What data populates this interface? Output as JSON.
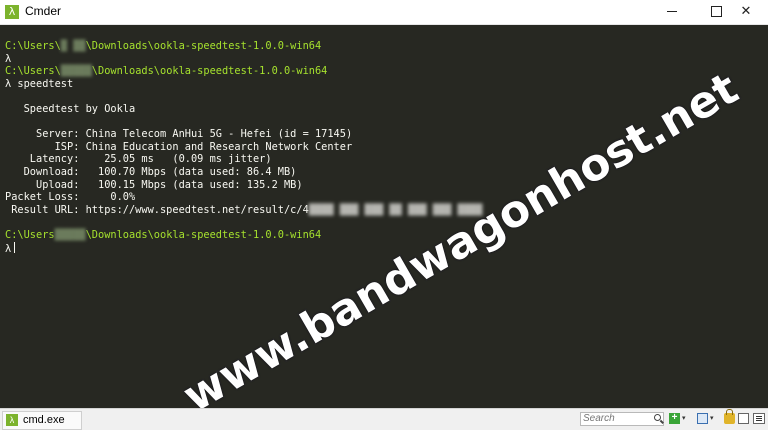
{
  "window": {
    "title": "Cmder",
    "icon_glyph": "λ",
    "controls": {
      "minimize": "minimize-icon",
      "maximize": "maximize-icon",
      "close": "✕"
    }
  },
  "console": {
    "colors": {
      "background": "#272822",
      "prompt_path": "#a6e22e",
      "text": "#f8f8f2"
    },
    "blocks": [
      {
        "type": "path",
        "prefix": "C:\\Users\\",
        "hidden": "█ ██",
        "suffix": "\\Downloads\\ookla-speedtest-1.0.0-win64"
      },
      {
        "type": "prompt",
        "text": "λ"
      },
      {
        "type": "path",
        "prefix": "C:\\Users\\",
        "hidden": "█████",
        "suffix": "\\Downloads\\ookla-speedtest-1.0.0-win64"
      },
      {
        "type": "prompt",
        "text": "λ speedtest"
      },
      {
        "type": "blank"
      },
      {
        "type": "text",
        "text": "   Speedtest by Ookla"
      },
      {
        "type": "blank"
      },
      {
        "type": "text",
        "text": "     Server: China Telecom AnHui 5G - Hefei (id = 17145)"
      },
      {
        "type": "text",
        "text": "        ISP: China Education and Research Network Center"
      },
      {
        "type": "text",
        "text": "    Latency:    25.05 ms   (0.09 ms jitter)"
      },
      {
        "type": "text",
        "text": "   Download:   100.70 Mbps (data used: 86.4 MB)"
      },
      {
        "type": "text",
        "text": "     Upload:   100.15 Mbps (data used: 135.2 MB)"
      },
      {
        "type": "text",
        "text": "Packet Loss:     0.0%"
      },
      {
        "type": "result",
        "text": " Result URL: https://www.speedtest.net/result/c/4",
        "hidden": "████ ███ ███ ██ ███ ███ ████"
      },
      {
        "type": "blank"
      },
      {
        "type": "path",
        "prefix": "C:\\Users",
        "hidden": "█████",
        "suffix": "\\Downloads\\ookla-speedtest-1.0.0-win64"
      },
      {
        "type": "prompt",
        "text": "λ",
        "cursor": true
      }
    ]
  },
  "watermark": "www.bandwagonhost.net",
  "statusbar": {
    "tab_label": "cmd.exe",
    "tab_icon": "λ",
    "search_placeholder": "Search",
    "add_symbol": "+",
    "dropdown_glyph": "▾"
  }
}
